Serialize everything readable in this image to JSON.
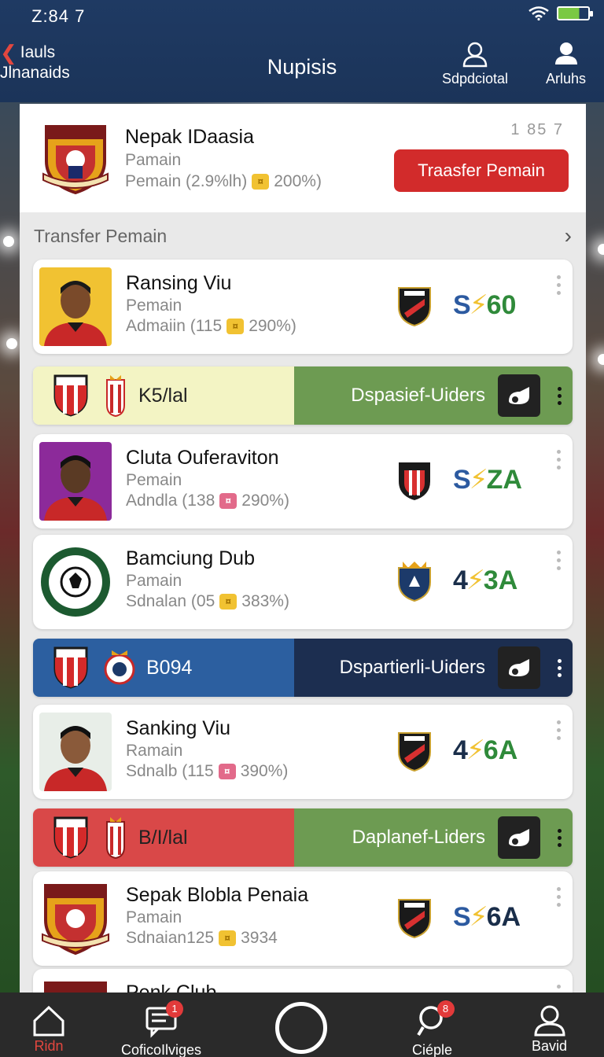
{
  "status": {
    "time": "Z:84 7"
  },
  "header": {
    "back_line1": "Iauls",
    "back_line2": "Jlnanaids",
    "title": "Nupisis",
    "action1_label": "Sdpdciotal",
    "action2_label": "Arluhs"
  },
  "club": {
    "name": "Nepak IDaasia",
    "sub": "Pamain",
    "meta_left": "Pemain (2.9%lh)",
    "meta_right": "200%)",
    "count": "1 85 7",
    "transfer_label": "Traasfer Pemain"
  },
  "section": {
    "title": "Transfer Pemain"
  },
  "players": [
    {
      "name": "Ransing Viu",
      "sub": "Pemain",
      "meta": "Admaiin (115",
      "pct": "290%)",
      "cur": "S",
      "val": "60",
      "skin": "#7a4a2a",
      "bg": "#f1c232"
    },
    {
      "name": "Cluta Ouferaviton",
      "sub": "Pemain",
      "meta": "Adndla (138",
      "pct": "290%)",
      "cur": "S",
      "val": "ZA",
      "skin": "#5a3a24",
      "bg": "#8c2a9a"
    },
    {
      "name": "Bamciung Dub",
      "sub": "Pamain",
      "meta": "Sdnalan (05",
      "pct": "383%)",
      "cur": "4",
      "val": "3A"
    },
    {
      "name": "Sanking Viu",
      "sub": "Ramain",
      "meta": "Sdnalb (115",
      "pct": "390%)",
      "cur": "4",
      "val": "6A",
      "skin": "#8a5a3a",
      "bg": "#e8eee8"
    },
    {
      "name": "Sepak Blobla Penaia",
      "sub": "Pamain",
      "meta": "Sdnaian125",
      "pct": "3934",
      "cur": "S",
      "val": "6A"
    },
    {
      "name": "Penk Club",
      "sub": "",
      "meta": "",
      "pct": "",
      "cur": "",
      "val": ""
    }
  ],
  "club_rows": [
    {
      "code": "K5/lal",
      "label": "Dspasief-Uiders"
    },
    {
      "code": "B094",
      "label": "Dspartierli-Uiders"
    },
    {
      "code": "B/I/lal",
      "label": "Daplanef-Liders"
    }
  ],
  "nav": {
    "home": "Ridn",
    "messages": "CoficoIlviges",
    "messages_badge": "1",
    "search": "Ciéple",
    "search_badge": "8",
    "profile": "Bavid"
  }
}
